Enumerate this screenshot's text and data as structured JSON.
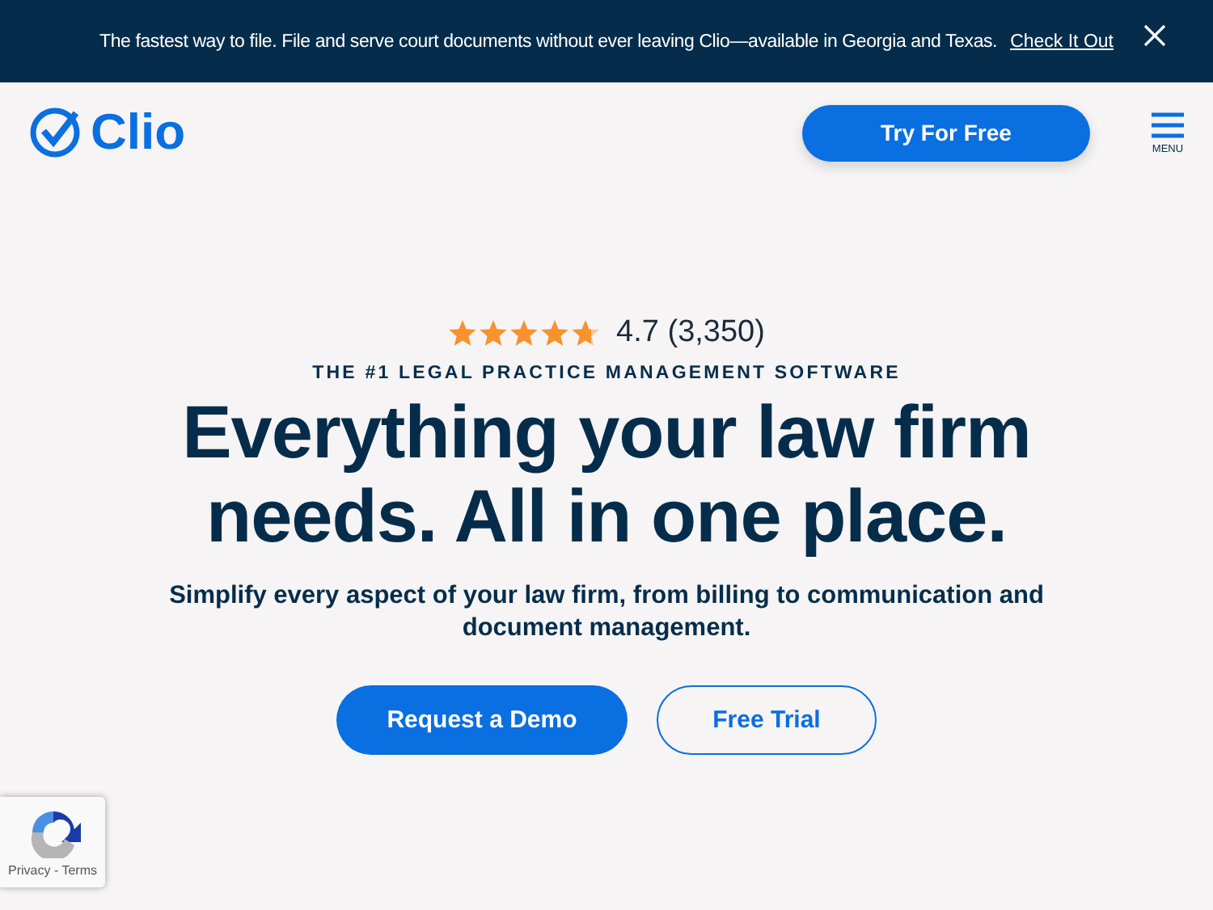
{
  "banner": {
    "text": "The fastest way to file. File and serve court documents without ever leaving Clio—available in Georgia and Texas.",
    "link": "Check It Out"
  },
  "header": {
    "logo": "Clio",
    "cta": "Try For Free",
    "menu_label": "MENU"
  },
  "hero": {
    "stars": 4.7,
    "rating": "4.7 (3,350)",
    "eyebrow": "THE #1 LEGAL PRACTICE MANAGEMENT SOFTWARE",
    "title_lines": [
      "Everything your law firm",
      "needs. All in one place."
    ],
    "subtitle": "Simplify every aspect of your law firm, from billing to communication and document management.",
    "buttons": [
      {
        "label": "Request a Demo",
        "kind": "primary"
      },
      {
        "label": "Free Trial",
        "kind": "outline"
      }
    ]
  },
  "recaptcha": {
    "links": "Privacy - Terms"
  }
}
